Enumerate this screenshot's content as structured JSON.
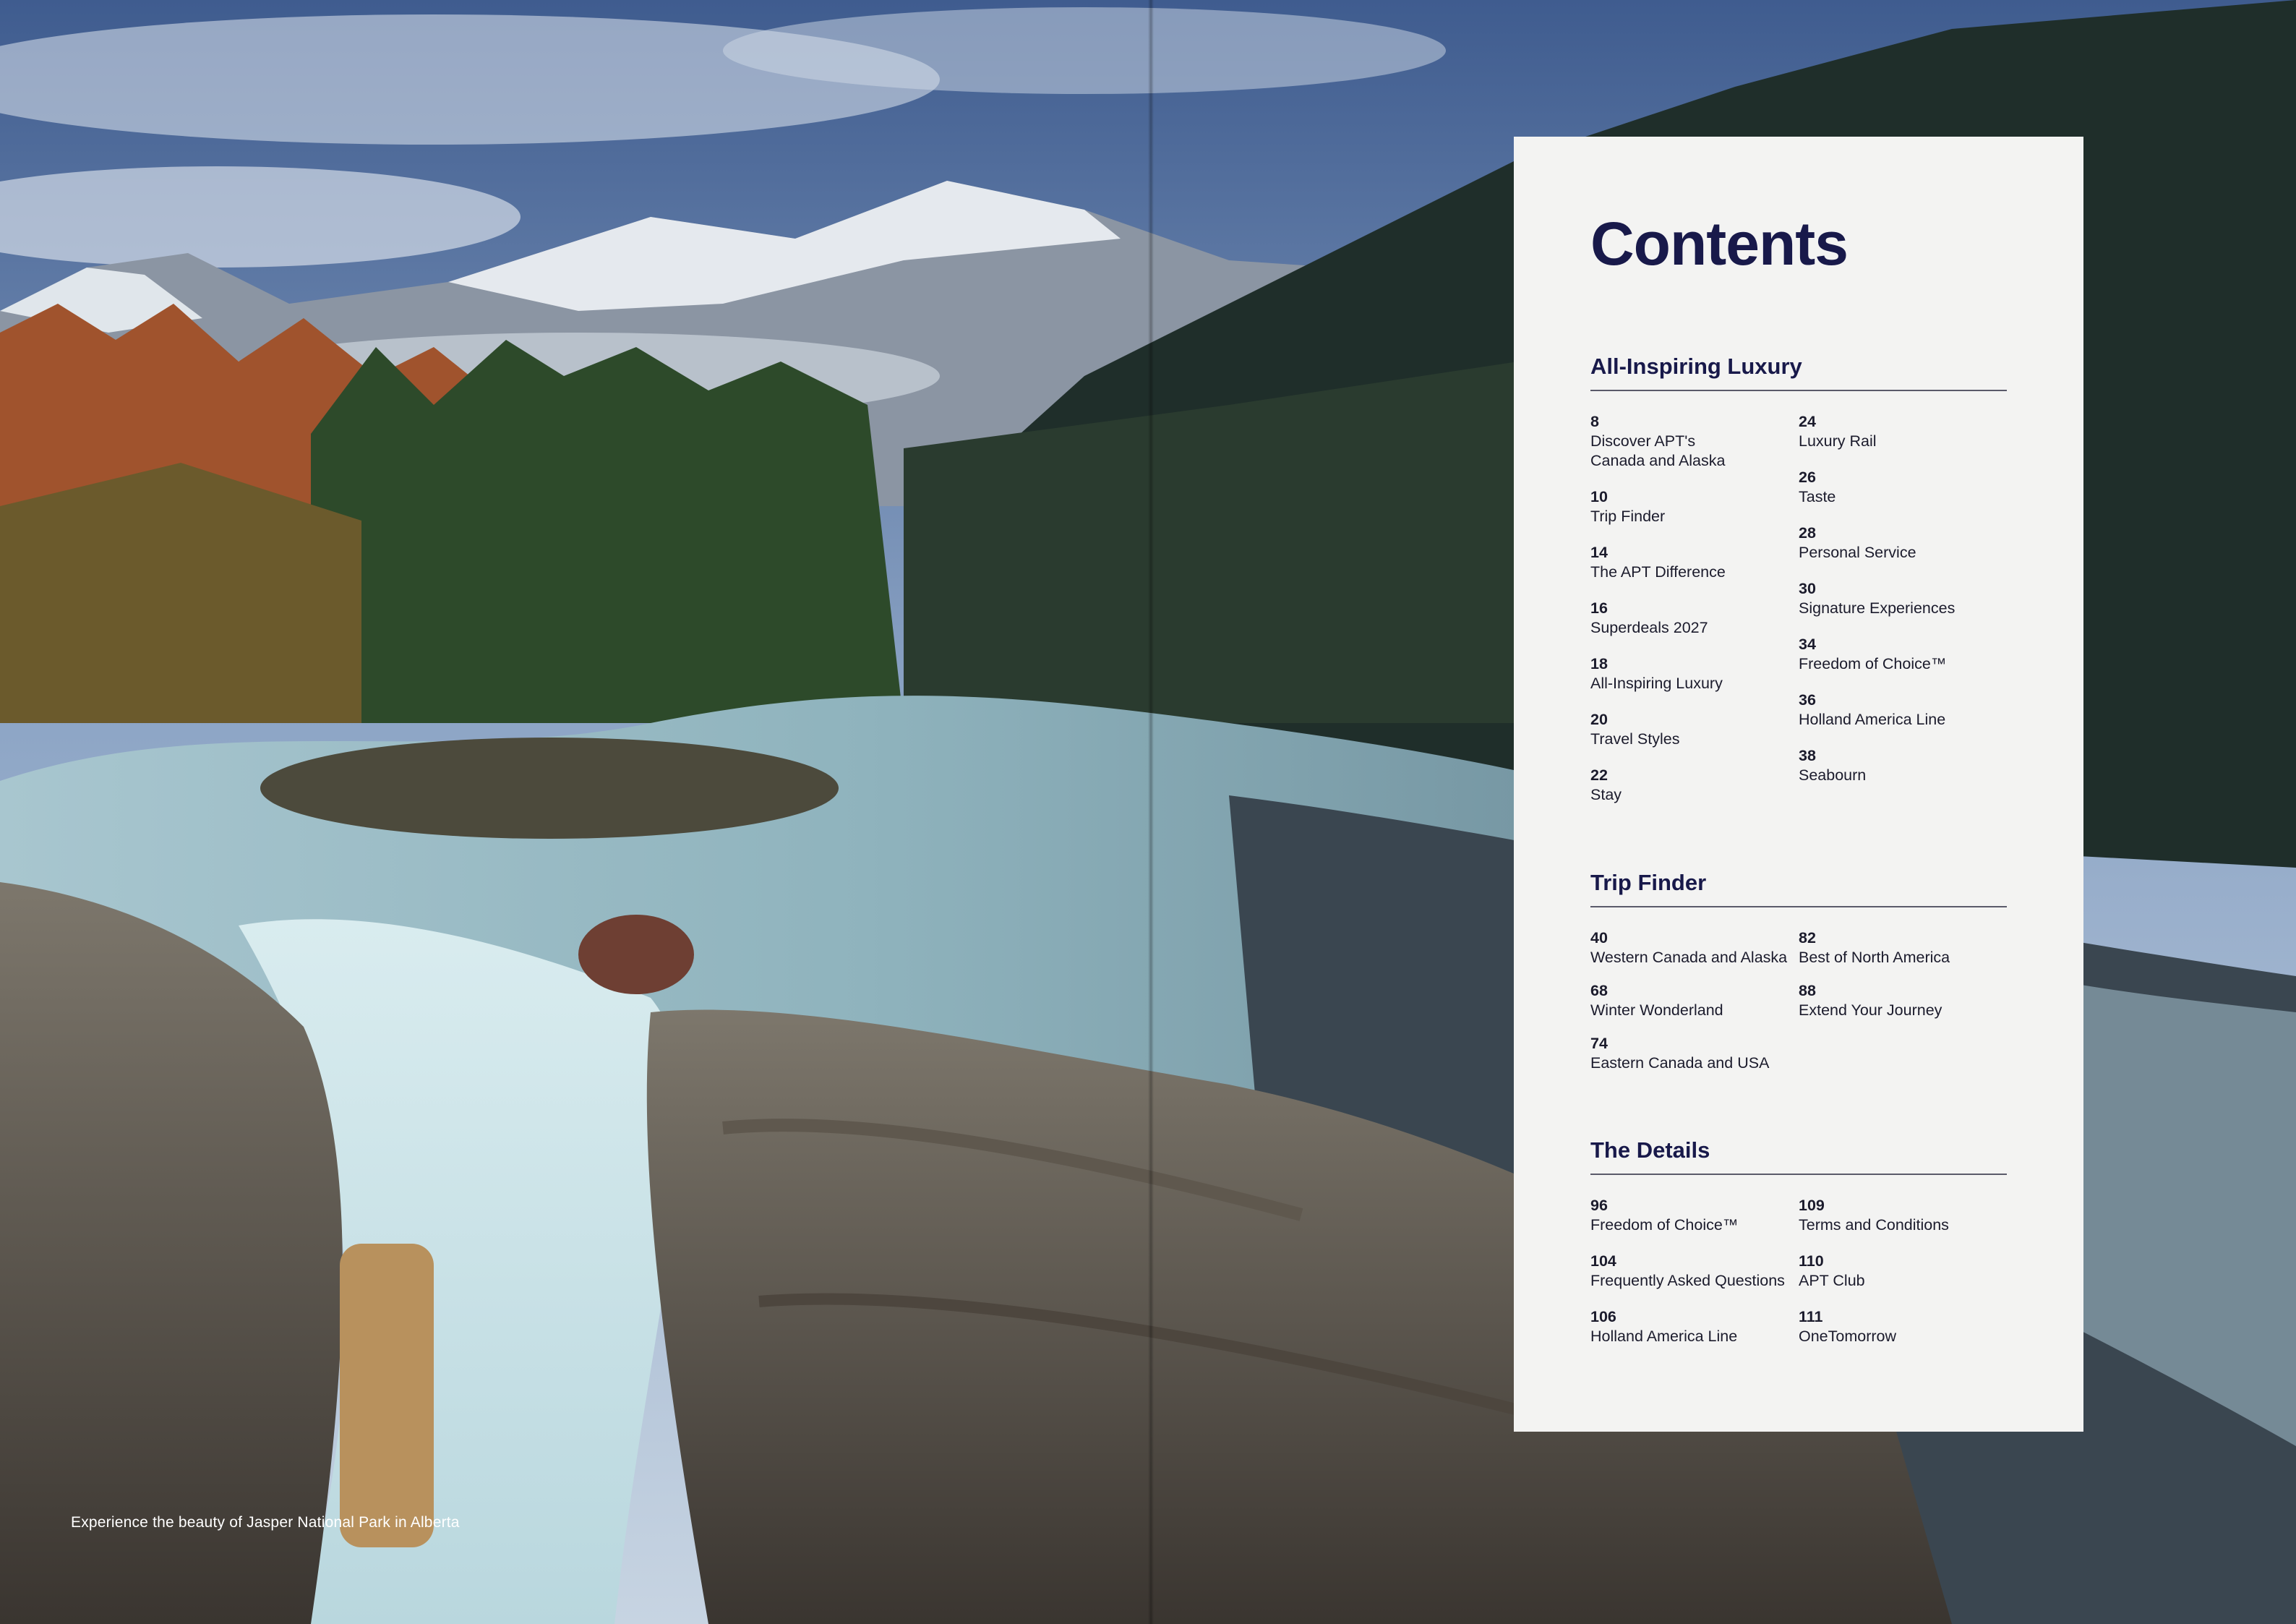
{
  "caption": "Experience the beauty of Jasper National Park in Alberta",
  "contents": {
    "title": "Contents",
    "sections": [
      {
        "title": "All-Inspiring Luxury",
        "left": [
          {
            "page": "8",
            "label": "Discover APT's\nCanada and Alaska"
          },
          {
            "page": "10",
            "label": "Trip Finder"
          },
          {
            "page": "14",
            "label": "The APT Difference"
          },
          {
            "page": "16",
            "label": "Superdeals 2027"
          },
          {
            "page": "18",
            "label": "All-Inspiring Luxury"
          },
          {
            "page": "20",
            "label": "Travel Styles"
          },
          {
            "page": "22",
            "label": "Stay"
          }
        ],
        "right": [
          {
            "page": "24",
            "label": "Luxury Rail"
          },
          {
            "page": "26",
            "label": "Taste"
          },
          {
            "page": "28",
            "label": "Personal Service"
          },
          {
            "page": "30",
            "label": "Signature Experiences"
          },
          {
            "page": "34",
            "label": "Freedom of Choice™"
          },
          {
            "page": "36",
            "label": "Holland America Line"
          },
          {
            "page": "38",
            "label": "Seabourn"
          }
        ]
      },
      {
        "title": "Trip Finder",
        "left": [
          {
            "page": "40",
            "label": "Western Canada and Alaska"
          },
          {
            "page": "68",
            "label": "Winter Wonderland"
          },
          {
            "page": "74",
            "label": "Eastern Canada and USA"
          }
        ],
        "right": [
          {
            "page": "82",
            "label": "Best of North America"
          },
          {
            "page": "88",
            "label": "Extend Your Journey"
          }
        ]
      },
      {
        "title": "The Details",
        "left": [
          {
            "page": "96",
            "label": "Freedom of Choice™"
          },
          {
            "page": "104",
            "label": "Frequently Asked Questions"
          },
          {
            "page": "106",
            "label": "Holland America Line"
          }
        ],
        "right": [
          {
            "page": "109",
            "label": "Terms and Conditions"
          },
          {
            "page": "110",
            "label": "APT Club"
          },
          {
            "page": "111",
            "label": "OneTomorrow"
          }
        ]
      }
    ]
  }
}
